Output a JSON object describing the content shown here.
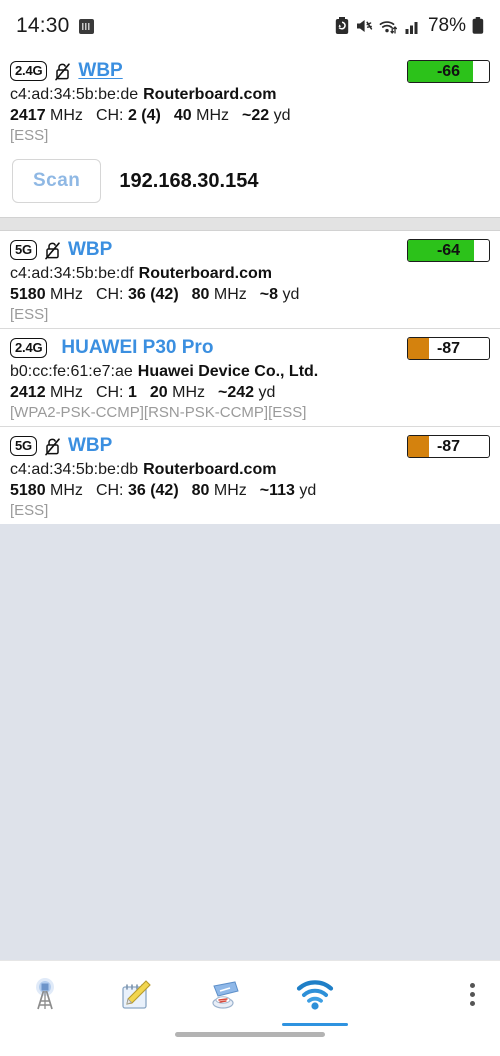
{
  "status_bar": {
    "time": "14:30",
    "battery_percent": "78%",
    "icons": [
      "app-notification-icon",
      "battery-saver-icon",
      "mute-bell-icon",
      "wifi-transfer-icon",
      "cellular-signal-icon",
      "battery-icon"
    ]
  },
  "scan_header": {
    "scan_label": "Scan",
    "ip_address": "192.168.30.154"
  },
  "colors": {
    "ssid_blue": "#3b8fe0",
    "signal_good": "#2cc21a",
    "signal_weak": "#d4820e",
    "accent": "#2f93e0",
    "empty_bg": "#dee2ea"
  },
  "networks": [
    {
      "band": "2.4G",
      "ssid": "WBP",
      "ssid_underlined": true,
      "lock_icon": "unlocked-slash-icon",
      "bssid": "c4:ad:34:5b:be:de",
      "vendor": "Routerboard.com",
      "frequency": "2417",
      "frequency_unit": "MHz",
      "channel_label": "CH:",
      "channel": "2 (4)",
      "width": "40",
      "width_unit": "MHz",
      "distance": "~22",
      "distance_unit": "yd",
      "capabilities": "[ESS]",
      "signal": "-66",
      "signal_color": "#2cc21a",
      "signal_fill_pct": 80
    },
    {
      "band": "5G",
      "ssid": "WBP",
      "ssid_underlined": false,
      "lock_icon": "unlocked-slash-icon",
      "bssid": "c4:ad:34:5b:be:df",
      "vendor": "Routerboard.com",
      "frequency": "5180",
      "frequency_unit": "MHz",
      "channel_label": "CH:",
      "channel": "36 (42)",
      "width": "80",
      "width_unit": "MHz",
      "distance": "~8",
      "distance_unit": "yd",
      "capabilities": "[ESS]",
      "signal": "-64",
      "signal_color": "#2cc21a",
      "signal_fill_pct": 82
    },
    {
      "band": "2.4G",
      "ssid": "HUAWEI P30 Pro",
      "ssid_underlined": false,
      "lock_icon": "",
      "bssid": "b0:cc:fe:61:e7:ae",
      "vendor": "Huawei Device Co., Ltd.",
      "frequency": "2412",
      "frequency_unit": "MHz",
      "channel_label": "CH:",
      "channel": "1",
      "width": "20",
      "width_unit": "MHz",
      "distance": "~242",
      "distance_unit": "yd",
      "capabilities": "[WPA2-PSK-CCMP][RSN-PSK-CCMP][ESS]",
      "signal": "-87",
      "signal_color": "#d4820e",
      "signal_fill_pct": 26
    },
    {
      "band": "5G",
      "ssid": "WBP",
      "ssid_underlined": false,
      "lock_icon": "unlocked-slash-icon",
      "bssid": "c4:ad:34:5b:be:db",
      "vendor": "Routerboard.com",
      "frequency": "5180",
      "frequency_unit": "MHz",
      "channel_label": "CH:",
      "channel": "36 (42)",
      "width": "80",
      "width_unit": "MHz",
      "distance": "~113",
      "distance_unit": "yd",
      "capabilities": "[ESS]",
      "signal": "-87",
      "signal_color": "#d4820e",
      "signal_fill_pct": 26
    }
  ],
  "bottom_nav": {
    "items": [
      {
        "icon": "antenna-tower-icon",
        "active": false
      },
      {
        "icon": "notepad-pencil-icon",
        "active": false
      },
      {
        "icon": "radar-dish-icon",
        "active": false
      },
      {
        "icon": "wifi-icon",
        "active": true
      }
    ],
    "overflow_icon": "three-dots-menu-icon"
  }
}
